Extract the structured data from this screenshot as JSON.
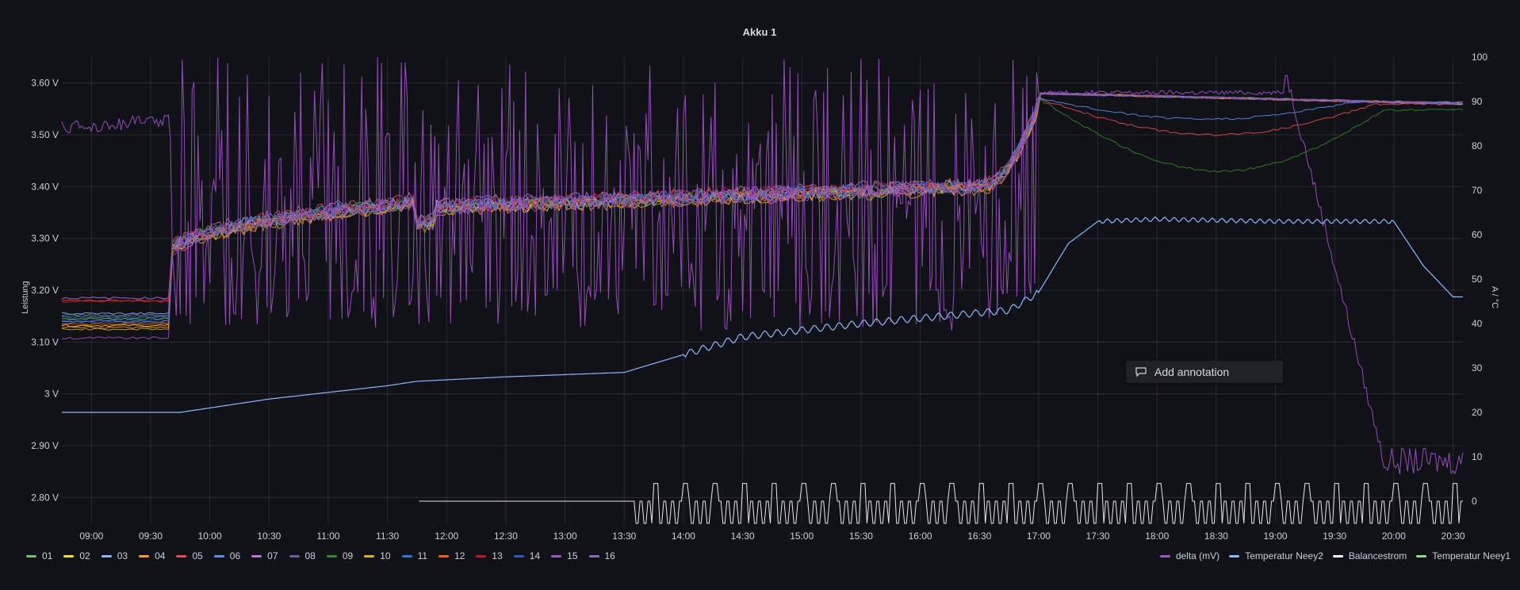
{
  "panel": {
    "title": "Akku 1"
  },
  "chart_data": {
    "type": "line",
    "title": "Akku 1",
    "ylabel_left": "Leistung",
    "ylabel_right": "A / °C",
    "x_ticks": [
      "09:00",
      "09:30",
      "10:00",
      "10:30",
      "11:00",
      "11:30",
      "12:00",
      "12:30",
      "13:00",
      "13:30",
      "14:00",
      "14:30",
      "15:00",
      "15:30",
      "16:00",
      "16:30",
      "17:00",
      "17:30",
      "18:00",
      "18:30",
      "19:00",
      "19:30",
      "20:00",
      "20:30"
    ],
    "x_range": [
      "08:45",
      "20:35"
    ],
    "y_left_ticks": [
      "3.60 V",
      "3.50 V",
      "3.40 V",
      "3.30 V",
      "3.20 V",
      "3.10 V",
      "3 V",
      "2.90 V",
      "2.80 V"
    ],
    "y_left_range": [
      2.75,
      3.65
    ],
    "y_right_ticks": [
      "100",
      "90",
      "80",
      "70",
      "60",
      "50",
      "40",
      "30",
      "20",
      "10",
      "0"
    ],
    "y_right_range": [
      -5,
      100
    ],
    "grid": true,
    "legend_placement": "bottom",
    "cell_series": [
      {
        "name": "01",
        "color": "#73bf69",
        "pre": 3.145,
        "end": 3.56,
        "offset": 0.0
      },
      {
        "name": "02",
        "color": "#fade2a",
        "pre": 3.132,
        "end": 3.56,
        "offset": -0.004
      },
      {
        "name": "03",
        "color": "#8ab8ff",
        "pre": 3.155,
        "end": 3.56,
        "offset": 0.003
      },
      {
        "name": "04",
        "color": "#ff9830",
        "pre": 3.128,
        "end": 3.56,
        "offset": -0.005
      },
      {
        "name": "05",
        "color": "#f2495c",
        "pre": 3.18,
        "end": 3.56,
        "offset": 0.006
      },
      {
        "name": "06",
        "color": "#5794f2",
        "pre": 3.14,
        "end": 3.56,
        "offset": 0.002
      },
      {
        "name": "07",
        "color": "#b877d9",
        "pre": 3.185,
        "end": 3.56,
        "offset": 0.008
      },
      {
        "name": "08",
        "color": "#705da0",
        "pre": 3.138,
        "end": 3.56,
        "offset": 0.0
      },
      {
        "name": "09",
        "color": "#37872d",
        "pre": 3.15,
        "end": 3.56,
        "offset": 0.004
      },
      {
        "name": "10",
        "color": "#e0b400",
        "pre": 3.125,
        "end": 3.56,
        "offset": -0.006
      },
      {
        "name": "11",
        "color": "#3274d9",
        "pre": 3.148,
        "end": 3.56,
        "offset": 0.001
      },
      {
        "name": "12",
        "color": "#fa6400",
        "pre": 3.135,
        "end": 3.56,
        "offset": -0.002
      },
      {
        "name": "13",
        "color": "#c4162a",
        "pre": 3.178,
        "end": 3.56,
        "offset": 0.005
      },
      {
        "name": "14",
        "color": "#1f60c4",
        "pre": 3.142,
        "end": 3.56,
        "offset": 0.0
      },
      {
        "name": "15",
        "color": "#a352cc",
        "pre": 3.108,
        "end": 3.56,
        "offset": -0.003
      },
      {
        "name": "16",
        "color": "#806eb7",
        "pre": 3.152,
        "end": 3.56,
        "offset": 0.002
      }
    ],
    "right_series": [
      {
        "name": "delta (mV)",
        "color": "#a352cc"
      },
      {
        "name": "Temperatur Neey2",
        "color": "#8ab8ff"
      },
      {
        "name": "Balancestrom",
        "color": "#ffffff"
      },
      {
        "name": "Temperatur Neey1",
        "color": "#96d98d"
      }
    ],
    "temperatur_neey2": {
      "x": [
        "08:45",
        "09:45",
        "10:30",
        "11:30",
        "11:45",
        "12:30",
        "13:30",
        "14:30",
        "15:30",
        "16:45",
        "17:00",
        "17:15",
        "17:30",
        "18:00",
        "19:00",
        "19:30",
        "20:00",
        "20:15",
        "20:30"
      ],
      "y": [
        20,
        20,
        23,
        26,
        27,
        28,
        29,
        37,
        40,
        43,
        47,
        58,
        63,
        63.5,
        63,
        63,
        63,
        53,
        46
      ]
    },
    "series_ranges": {
      "delta_mv": {
        "min": 0,
        "max": 100
      },
      "balancestrom": {
        "min": -5,
        "max": 0
      }
    }
  },
  "legend": {
    "left": [
      "01",
      "02",
      "03",
      "04",
      "05",
      "06",
      "07",
      "08",
      "09",
      "10",
      "11",
      "12",
      "13",
      "14",
      "15",
      "16"
    ],
    "right": [
      "delta (mV)",
      "Temperatur Neey2",
      "Balancestrom",
      "Temperatur Neey1"
    ]
  },
  "annotation": {
    "label": "Add annotation"
  }
}
